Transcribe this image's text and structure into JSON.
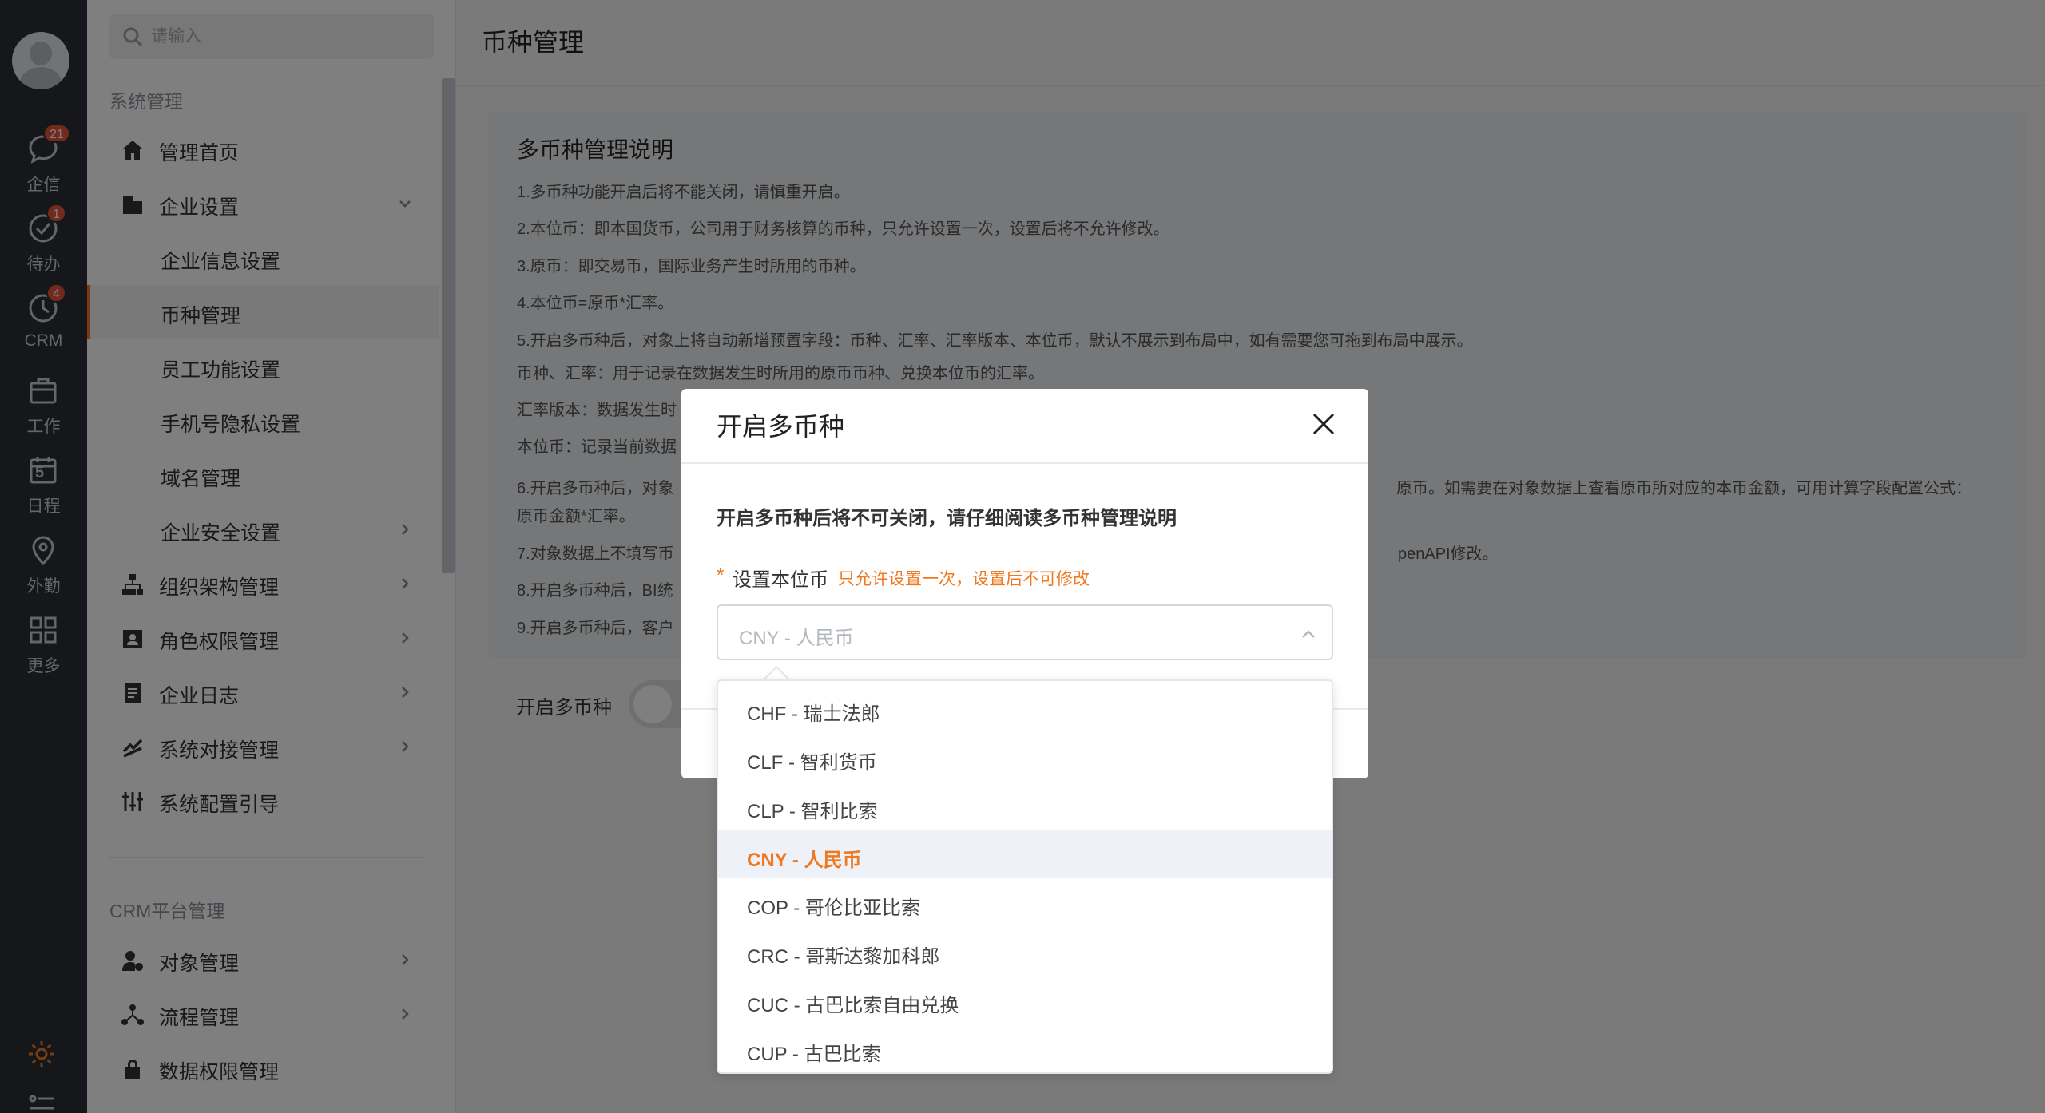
{
  "rail": {
    "items": [
      {
        "label": "企信",
        "badge": "21"
      },
      {
        "label": "待办",
        "badge": "1"
      },
      {
        "label": "CRM",
        "badge": "4"
      },
      {
        "label": "工作",
        "badge": ""
      },
      {
        "label": "日程",
        "badge": ""
      },
      {
        "label": "外勤",
        "badge": ""
      },
      {
        "label": "更多",
        "badge": ""
      }
    ],
    "calendar_day": "5"
  },
  "search": {
    "placeholder": "请输入"
  },
  "subnav": {
    "group1_title": "系统管理",
    "items": [
      {
        "label": "管理首页"
      },
      {
        "label": "企业设置"
      },
      {
        "label": "企业信息设置"
      },
      {
        "label": "币种管理"
      },
      {
        "label": "员工功能设置"
      },
      {
        "label": "手机号隐私设置"
      },
      {
        "label": "域名管理"
      },
      {
        "label": "企业安全设置"
      },
      {
        "label": "组织架构管理"
      },
      {
        "label": "角色权限管理"
      },
      {
        "label": "企业日志"
      },
      {
        "label": "系统对接管理"
      },
      {
        "label": "系统配置引导"
      }
    ],
    "group2_title": "CRM平台管理",
    "items2": [
      {
        "label": "对象管理"
      },
      {
        "label": "流程管理"
      },
      {
        "label": "数据权限管理"
      }
    ]
  },
  "main": {
    "page_title": "币种管理",
    "info_title": "多币种管理说明",
    "lines": [
      "1.多币种功能开启后将不能关闭，请慎重开启。",
      "2.本位币：即本国货币，公司用于财务核算的币种，只允许设置一次，设置后将不允许修改。",
      "3.原币：即交易币，国际业务产生时所用的币种。",
      "4.本位币=原币*汇率。",
      "5.开启多币种后，对象上将自动新增预置字段：币种、汇率、汇率版本、本位币，默认不展示到布局中，如有需要您可拖到布局中展示。",
      "币种、汇率：用于记录在数据发生时所用的原币币种、兑换本位币的汇率。",
      "汇率版本：数据发生时",
      "本位币：记录当前数据",
      "6.开启多币种后，对象",
      "原币。如需要在对象数据上查看原币所对应的本币金额，可用计算字段配置公式：",
      "原币金额*汇率。",
      "7.对象数据上不填写币",
      "penAPI修改。",
      "8.开启多币种后，BI统",
      "9.开启多币种后，客户"
    ],
    "switch_label": "开启多币种"
  },
  "modal": {
    "title": "开启多币种",
    "warning": "开启多币种后将不可关闭，请仔细阅读多币种管理说明",
    "required_mark": "*",
    "field_label": "设置本位币",
    "field_hint": "只允许设置一次，设置后不可修改",
    "select_value": "CNY - 人民币"
  },
  "dropdown": {
    "options": [
      {
        "label": "CHF - 瑞士法郎"
      },
      {
        "label": "CLF - 智利货币"
      },
      {
        "label": "CLP - 智利比索"
      },
      {
        "label": "CNY - 人民币"
      },
      {
        "label": "COP - 哥伦比亚比索"
      },
      {
        "label": "CRC - 哥斯达黎加科郎"
      },
      {
        "label": "CUC - 古巴比索自由兑换"
      },
      {
        "label": "CUP - 古巴比索"
      }
    ],
    "selected": "CNY - 人民币"
  },
  "colors": {
    "accent": "#f0781e",
    "rail_bg": "#2b2f36",
    "badge": "#e5543a"
  }
}
